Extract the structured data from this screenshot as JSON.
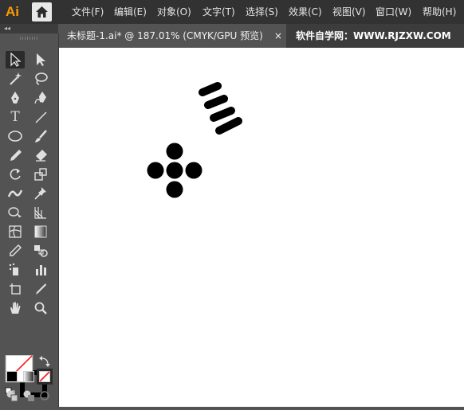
{
  "app": {
    "logo": "Ai"
  },
  "menubar": {
    "items": [
      "文件(F)",
      "编辑(E)",
      "对象(O)",
      "文字(T)",
      "选择(S)",
      "效果(C)",
      "视图(V)",
      "窗口(W)",
      "帮助(H)"
    ]
  },
  "toolbar": {
    "collapse": "◂◂",
    "tools": [
      "selection-tool",
      "direct-selection-tool",
      "magic-wand-tool",
      "lasso-tool",
      "pen-tool",
      "curvature-tool",
      "type-tool",
      "line-segment-tool",
      "ellipse-tool",
      "paintbrush-tool",
      "pencil-tool",
      "eraser-tool",
      "rotate-tool",
      "scale-tool",
      "width-tool",
      "puppet-warp-tool",
      "shape-builder-tool",
      "perspective-grid-tool",
      "mesh-tool",
      "gradient-tool",
      "eyedropper-tool",
      "blend-tool",
      "symbol-sprayer-tool",
      "column-graph-tool",
      "artboard-tool",
      "slice-tool",
      "hand-tool",
      "zoom-tool"
    ],
    "type_glyph": "T",
    "fill_color": "#ffffff",
    "stroke_color": "#000000"
  },
  "document": {
    "tab_title": "未标题-1.ai* @ 187.01% (CMYK/GPU 预览)",
    "close_glyph": "×",
    "watermark": "软件自学网：WWW.RJZXW.COM"
  }
}
